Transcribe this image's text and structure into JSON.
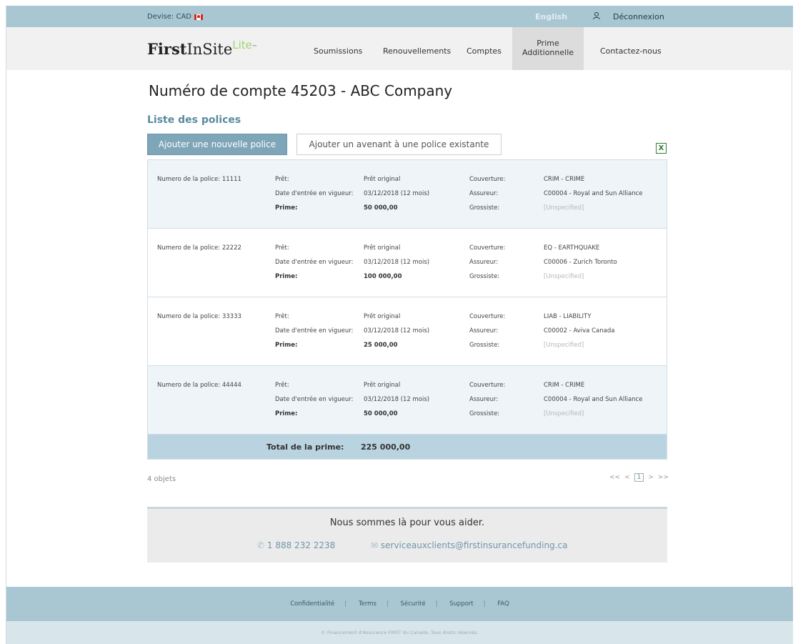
{
  "topbar": {
    "currency": "Devise: CAD",
    "language": "English",
    "logout": "Déconnexion"
  },
  "header": {
    "logo_first": "First",
    "logo_insite": "InSite",
    "logo_lite": "Lite",
    "logo_tm": "™",
    "nav": {
      "submissions": "Soumissions",
      "renewals": "Renouvellements",
      "accounts": "Comptes",
      "additional_premium_line1": "Prime",
      "additional_premium_line2": "Additionnelle",
      "contact": "Contactez-nous"
    }
  },
  "page": {
    "title": "Numéro de compte 45203 - ABC Company",
    "section_title": "Liste des polices",
    "add_policy_button": "Ajouter une nouvelle police",
    "add_endorsement_button": "Ajouter un avenant à une police existante",
    "excel_label": "X"
  },
  "labels": {
    "loan": "Prêt:",
    "effective_date": "Date d'entrée en vigueur:",
    "premium": "Prime:",
    "coverage": "Couverture:",
    "insurer": "Assureur:",
    "wholesaler": "Grossiste:"
  },
  "policies": [
    {
      "number": "Numero de la police: 11111",
      "loan": "Prêt original",
      "date": "03/12/2018 (12 mois)",
      "premium": "50 000,00",
      "coverage": "CRIM - CRIME",
      "insurer": "C00004 - Royal and Sun Alliance",
      "wholesaler": "[Unspecified]"
    },
    {
      "number": "Numero de la police: 22222",
      "loan": "Prêt original",
      "date": "03/12/2018 (12 mois)",
      "premium": "100 000,00",
      "coverage": "EQ - EARTHQUAKE",
      "insurer": "C00006 - Zurich Toronto",
      "wholesaler": "[Unspecified]"
    },
    {
      "number": "Numero de la police: 33333",
      "loan": "Prêt original",
      "date": "03/12/2018 (12 mois)",
      "premium": "25 000,00",
      "coverage": "LIAB - LIABILITY",
      "insurer": "C00002 - Aviva Canada",
      "wholesaler": "[Unspecified]"
    },
    {
      "number": "Numero de la police: 44444",
      "loan": "Prêt original",
      "date": "03/12/2018 (12 mois)",
      "premium": "50 000,00",
      "coverage": "CRIM - CRIME",
      "insurer": "C00004 - Royal and Sun Alliance",
      "wholesaler": "[Unspecified]"
    }
  ],
  "total": {
    "label": "Total de la prime:",
    "value": "225 000,00"
  },
  "pagination": {
    "count": "4 objets",
    "first": "<<",
    "prev": "<",
    "current": "1",
    "next": ">",
    "last": ">>"
  },
  "help": {
    "title": "Nous sommes là pour vous aider.",
    "phone": "1 888 232 2238",
    "email": "serviceauxclients@firstinsurancefunding.ca"
  },
  "footer": {
    "links": [
      "Confidentialité",
      "Terms",
      "Sécurité",
      "Support",
      "FAQ"
    ],
    "separator": "|",
    "copyright": "© Financement d'Assurance FIRST du Canada. Tous droits réservés."
  },
  "colors": {
    "accent": "#7ea6b8",
    "topbar": "#a9c6d3",
    "logo_lite": "#9fd36e",
    "excel": "#2e7d32"
  }
}
